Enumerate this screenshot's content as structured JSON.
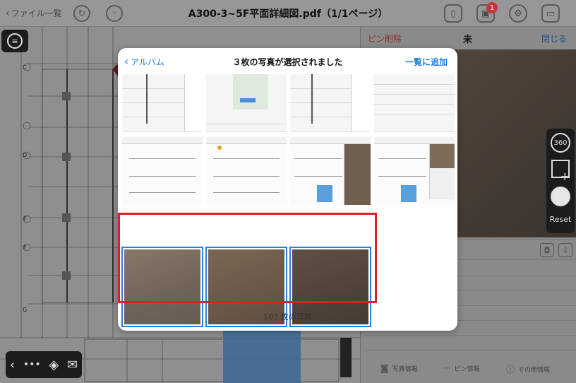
{
  "topbar": {
    "back_label": "ファイル一覧",
    "title": "A300-3~5F平面詳細図.pdf（1/1ページ）",
    "badge_count": "1"
  },
  "drawing": {
    "grid_labels": [
      "C",
      "D",
      "E",
      "F",
      "G"
    ]
  },
  "right_pane": {
    "pin_delete": "ピン削除",
    "pin_title": "未",
    "close": "閉じる",
    "reset": "Reset",
    "tabs": [
      "写真情報",
      "ピン情報",
      "その他情報"
    ]
  },
  "modal": {
    "back": "アルバム",
    "title": "３枚の写真が選択されました",
    "add": "一覧に追加",
    "count": "103 枚の写真"
  },
  "colors": {
    "accent": "#1f7ae0",
    "selection": "#2d7ed8",
    "highlight": "#e02020",
    "badge": "#c8323a"
  }
}
